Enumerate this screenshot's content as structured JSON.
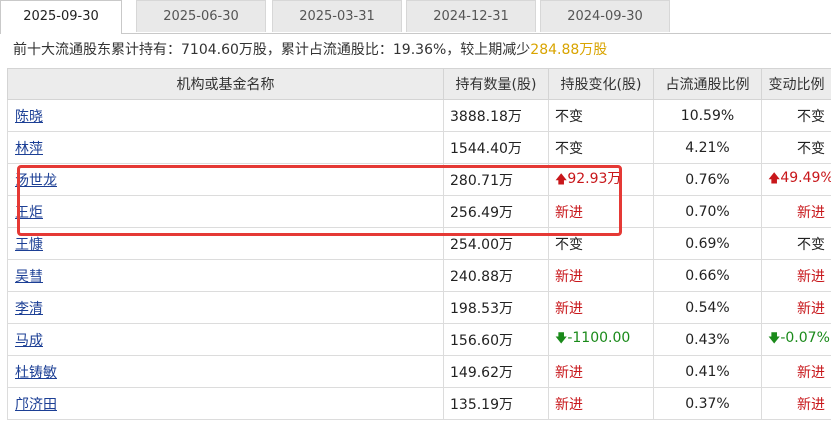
{
  "tabs": [
    "2025-09-30",
    "2025-06-30",
    "2025-03-31",
    "2024-12-31",
    "2024-09-30"
  ],
  "summary": {
    "prefix": "前十大流通股东累计持有：7104.60万股，累计占流通股比：19.36%，较上期减少",
    "change": "284.88万股"
  },
  "columns": [
    "机构或基金名称",
    "持有数量(股)",
    "持股变化(股)",
    "占流通股比例",
    "变动比例"
  ],
  "rows": [
    {
      "name": "陈晓",
      "shares": "3888.18万",
      "change": "不变",
      "change_type": "same",
      "ratio": "10.59%",
      "pct": "不变",
      "pct_type": "same"
    },
    {
      "name": "林萍",
      "shares": "1544.40万",
      "change": "不变",
      "change_type": "same",
      "ratio": "4.21%",
      "pct": "不变",
      "pct_type": "same"
    },
    {
      "name": "汤世龙",
      "shares": "280.71万",
      "change": "92.93万",
      "change_type": "up",
      "ratio": "0.76%",
      "pct": "49.49%",
      "pct_type": "up"
    },
    {
      "name": "王炬",
      "shares": "256.49万",
      "change": "新进",
      "change_type": "new",
      "ratio": "0.70%",
      "pct": "新进",
      "pct_type": "new"
    },
    {
      "name": "王慷",
      "shares": "254.00万",
      "change": "不变",
      "change_type": "same",
      "ratio": "0.69%",
      "pct": "不变",
      "pct_type": "same"
    },
    {
      "name": "吴彗",
      "shares": "240.88万",
      "change": "新进",
      "change_type": "new",
      "ratio": "0.66%",
      "pct": "新进",
      "pct_type": "new"
    },
    {
      "name": "李清",
      "shares": "198.53万",
      "change": "新进",
      "change_type": "new",
      "ratio": "0.54%",
      "pct": "新进",
      "pct_type": "new"
    },
    {
      "name": "马成",
      "shares": "156.60万",
      "change": "-1100.00",
      "change_type": "down",
      "ratio": "0.43%",
      "pct": "-0.07%",
      "pct_type": "down"
    },
    {
      "name": "杜铸敏",
      "shares": "149.62万",
      "change": "新进",
      "change_type": "new",
      "ratio": "0.41%",
      "pct": "新进",
      "pct_type": "new"
    },
    {
      "name": "邝济田",
      "shares": "135.19万",
      "change": "新进",
      "change_type": "new",
      "ratio": "0.37%",
      "pct": "新进",
      "pct_type": "new"
    }
  ],
  "colors": {
    "red": "#c8171b",
    "green": "#1a8a1a",
    "link": "#1c3f95",
    "highlight": "#e53935",
    "summary_change": "#d9a400"
  }
}
